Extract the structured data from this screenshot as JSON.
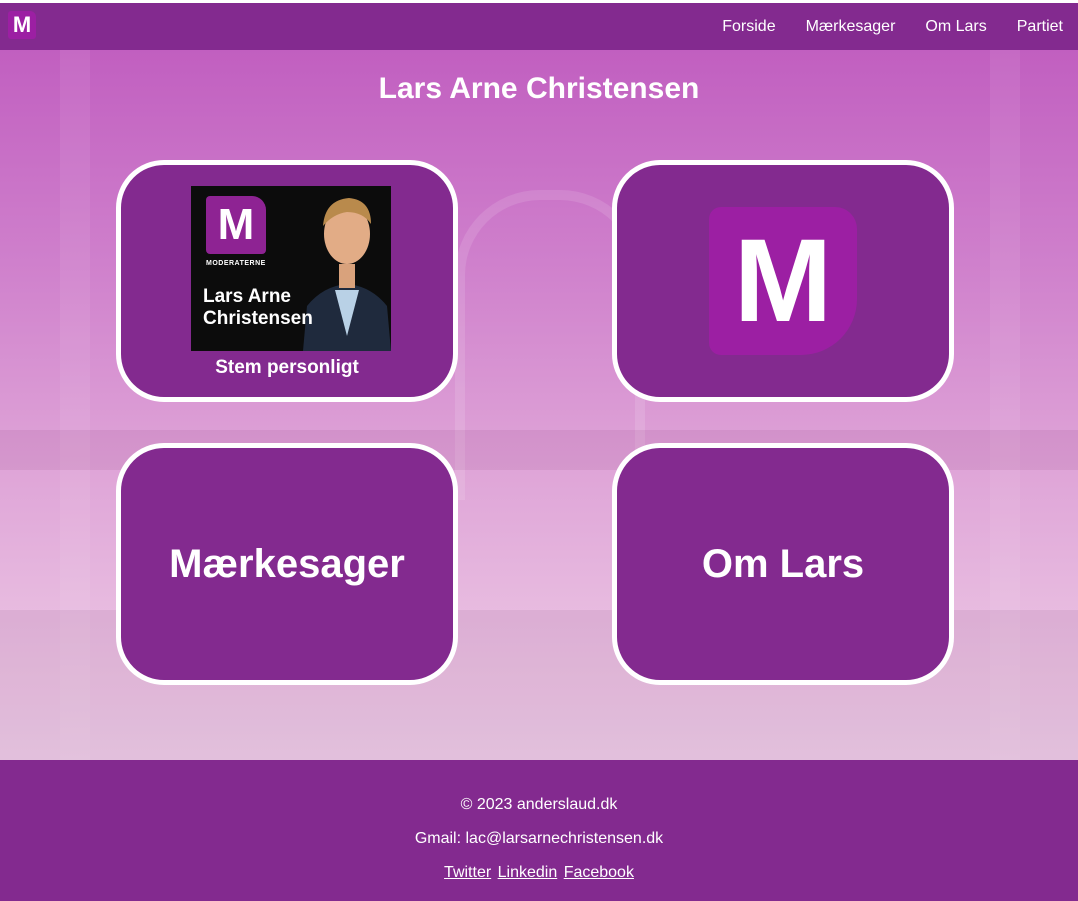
{
  "nav": {
    "logo_letter": "M",
    "links": [
      "Forside",
      "Mærkesager",
      "Om Lars",
      "Partiet"
    ]
  },
  "main": {
    "title": "Lars Arne Christensen",
    "tiles": {
      "poster": {
        "logo_letter": "M",
        "brand": "MODERATERNE",
        "name": "Lars Arne Christensen",
        "subtitle": "Stem personligt"
      },
      "party_logo_letter": "M",
      "maerkesager_label": "Mærkesager",
      "om_lars_label": "Om Lars"
    }
  },
  "footer": {
    "copyright": "© 2023 anderslaud.dk",
    "email": "Gmail: lac@larsarnechristensen.dk",
    "links": [
      "Twitter",
      "Linkedin",
      "Facebook"
    ]
  },
  "colors": {
    "brand_purple": "#832a8f",
    "logo_magenta": "#9c1fa3"
  },
  "icons": [
    "moderaterne-logo-icon"
  ]
}
